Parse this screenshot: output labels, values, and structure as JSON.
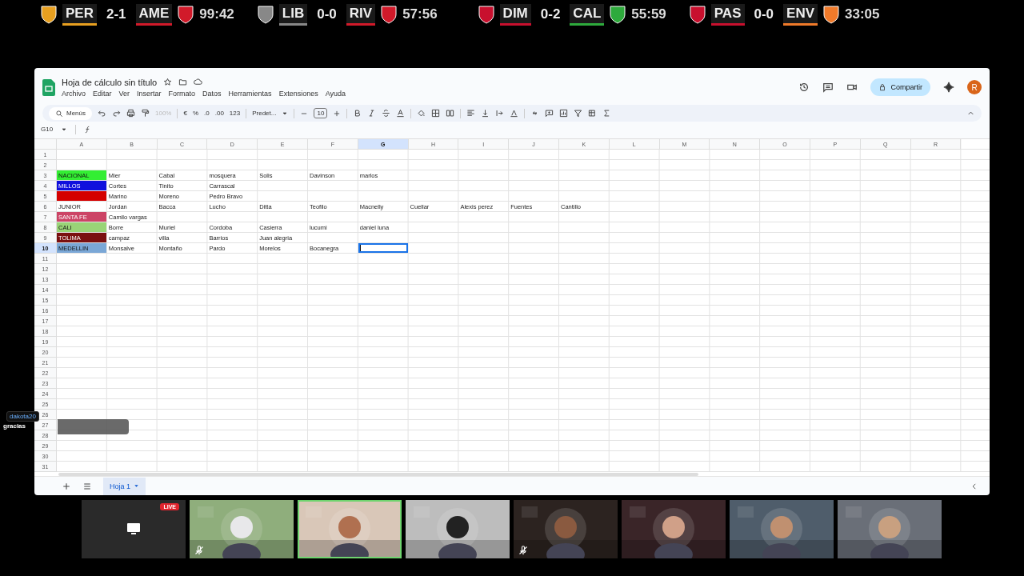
{
  "scoreboard": [
    {
      "home": {
        "code": "PER",
        "color": "#e8a020"
      },
      "score": "2-1",
      "away": {
        "code": "AME",
        "color": "#d11a2a"
      },
      "time": "99:42"
    },
    {
      "home": {
        "code": "LIB",
        "color": "#888888"
      },
      "score": "0-0",
      "away": {
        "code": "RIV",
        "color": "#d11a2a"
      },
      "time": "57:56"
    },
    {
      "home": {
        "code": "DIM",
        "color": "#c8102e"
      },
      "score": "0-2",
      "away": {
        "code": "CAL",
        "color": "#2eaa3c"
      },
      "time": "55:59"
    },
    {
      "home": {
        "code": "PAS",
        "color": "#c8102e"
      },
      "score": "0-0",
      "away": {
        "code": "ENV",
        "color": "#f07a2a"
      },
      "time": "33:05"
    }
  ],
  "window": {
    "title": "Hoja de cálculo sin título",
    "menu": [
      "Archivo",
      "Editar",
      "Ver",
      "Insertar",
      "Formato",
      "Datos",
      "Herramientas",
      "Extensiones",
      "Ayuda"
    ],
    "share_button": "Compartir",
    "avatar": "R"
  },
  "toolbar": {
    "search": "Menús",
    "zoom": {
      "label": "100%",
      "disabled": true
    },
    "currency": "€",
    "percent": "%",
    "decrease_decimals": ".0",
    "increase_decimals": ".00",
    "number_format": "123",
    "font": "Predet...",
    "font_size": "10"
  },
  "formula_bar": {
    "name_box": "G10"
  },
  "grid": {
    "columns": [
      {
        "label": "A",
        "selected": false
      },
      {
        "label": "B",
        "selected": false
      },
      {
        "label": "C",
        "selected": false
      },
      {
        "label": "D",
        "selected": false
      },
      {
        "label": "E",
        "selected": false
      },
      {
        "label": "F",
        "selected": false
      },
      {
        "label": "G",
        "selected": true
      },
      {
        "label": "H",
        "selected": false
      },
      {
        "label": "I",
        "selected": false
      },
      {
        "label": "J",
        "selected": false
      },
      {
        "label": "K",
        "selected": false
      },
      {
        "label": "L",
        "selected": false
      },
      {
        "label": "M",
        "selected": false
      },
      {
        "label": "N",
        "selected": false
      },
      {
        "label": "O",
        "selected": false
      },
      {
        "label": "P",
        "selected": false
      },
      {
        "label": "Q",
        "selected": false
      },
      {
        "label": "R",
        "selected": false
      }
    ],
    "rows": [
      {
        "number": "1",
        "selected": false
      },
      {
        "number": "2",
        "selected": false
      },
      {
        "number": "3",
        "selected": false,
        "cells": [
          {
            "text": "NACIONAL",
            "color": "#33ee33"
          },
          {
            "text": "Mier"
          },
          {
            "text": "Cabal"
          },
          {
            "text": "mosquera"
          },
          {
            "text": "Solis"
          },
          {
            "text": "Davinson"
          },
          {
            "text": "marlos"
          }
        ]
      },
      {
        "number": "4",
        "selected": false,
        "cells": [
          {
            "text": "MILLOS",
            "color": "#1010dd"
          },
          {
            "text": "Cortes"
          },
          {
            "text": "Tinito"
          },
          {
            "text": "Carrascal"
          }
        ]
      },
      {
        "number": "5",
        "selected": false,
        "cells": [
          {
            "color": "#d40000"
          },
          {
            "text": "Marino"
          },
          {
            "text": "Moreno"
          },
          {
            "text": "Pedro Bravo"
          }
        ]
      },
      {
        "number": "6",
        "selected": false,
        "cells": [
          {
            "text": "JUNIOR"
          },
          {
            "text": "Jordan"
          },
          {
            "text": "Bacca"
          },
          {
            "text": "Lucho"
          },
          {
            "text": "Ditta"
          },
          {
            "text": "Teofilo"
          },
          {
            "text": "Macnelly"
          },
          {
            "text": "Cuellar"
          },
          {
            "text": "Alexis perez"
          },
          {
            "text": "Fuentes"
          },
          {
            "text": "Cantillo"
          }
        ]
      },
      {
        "number": "7",
        "selected": false,
        "cells": [
          {
            "text": "SANTA FE",
            "color": "#cc4466"
          },
          {
            "text": "Camilo vargas"
          }
        ]
      },
      {
        "number": "8",
        "selected": false,
        "cells": [
          {
            "text": "CALI",
            "color": "#99d477"
          },
          {
            "text": "Borre"
          },
          {
            "text": "Muriel"
          },
          {
            "text": "Cordoba"
          },
          {
            "text": "Casierra"
          },
          {
            "text": "lucumi"
          },
          {
            "text": "daniel luna"
          }
        ]
      },
      {
        "number": "9",
        "selected": false,
        "cells": [
          {
            "text": "TOLIMA",
            "color": "#7a1010"
          },
          {
            "text": "campaz"
          },
          {
            "text": "villa"
          },
          {
            "text": "Barrios"
          },
          {
            "text": "Juan alegria"
          }
        ]
      },
      {
        "number": "10",
        "selected": true,
        "cells": [
          {
            "text": "MEDELLIN",
            "color": "#7aa7d6"
          },
          {
            "text": "Monsalve"
          },
          {
            "text": "Montaño"
          },
          {
            "text": "Pardo"
          },
          {
            "text": "Morelos"
          },
          {
            "text": "Bocanegra"
          },
          {
            "selected": true
          }
        ]
      },
      {
        "number": "11",
        "selected": false
      },
      {
        "number": "12",
        "selected": false
      },
      {
        "number": "13",
        "selected": false
      },
      {
        "number": "14",
        "selected": false
      },
      {
        "number": "15",
        "selected": false
      },
      {
        "number": "16",
        "selected": false
      },
      {
        "number": "17",
        "selected": false
      },
      {
        "number": "18",
        "selected": false
      },
      {
        "number": "19",
        "selected": false
      },
      {
        "number": "20",
        "selected": false
      },
      {
        "number": "21",
        "selected": false
      },
      {
        "number": "22",
        "selected": false
      },
      {
        "number": "23",
        "selected": false
      },
      {
        "number": "24",
        "selected": false
      },
      {
        "number": "25",
        "selected": false
      },
      {
        "number": "26",
        "selected": false
      },
      {
        "number": "27",
        "selected": false
      },
      {
        "number": "28",
        "selected": false
      },
      {
        "number": "29",
        "selected": false
      },
      {
        "number": "30",
        "selected": false
      },
      {
        "number": "31",
        "selected": false
      }
    ]
  },
  "sheet_tabs": [
    {
      "label": "Hoja 1",
      "selected": true
    }
  ],
  "chat": {
    "user": "dakota20",
    "message": "gracias"
  },
  "participants": [
    {
      "kind": "screen",
      "badge": "LIVE",
      "speaking": false,
      "muted": false
    },
    {
      "kind": "picture",
      "speaking": false,
      "muted": true
    },
    {
      "kind": "picture",
      "speaking": true,
      "muted": false
    },
    {
      "kind": "picture",
      "speaking": false,
      "muted": false
    },
    {
      "kind": "picture",
      "speaking": false,
      "muted": true
    },
    {
      "kind": "picture",
      "speaking": false,
      "muted": false
    },
    {
      "kind": "picture",
      "speaking": false,
      "muted": false
    },
    {
      "kind": "picture",
      "speaking": false,
      "muted": false
    }
  ]
}
